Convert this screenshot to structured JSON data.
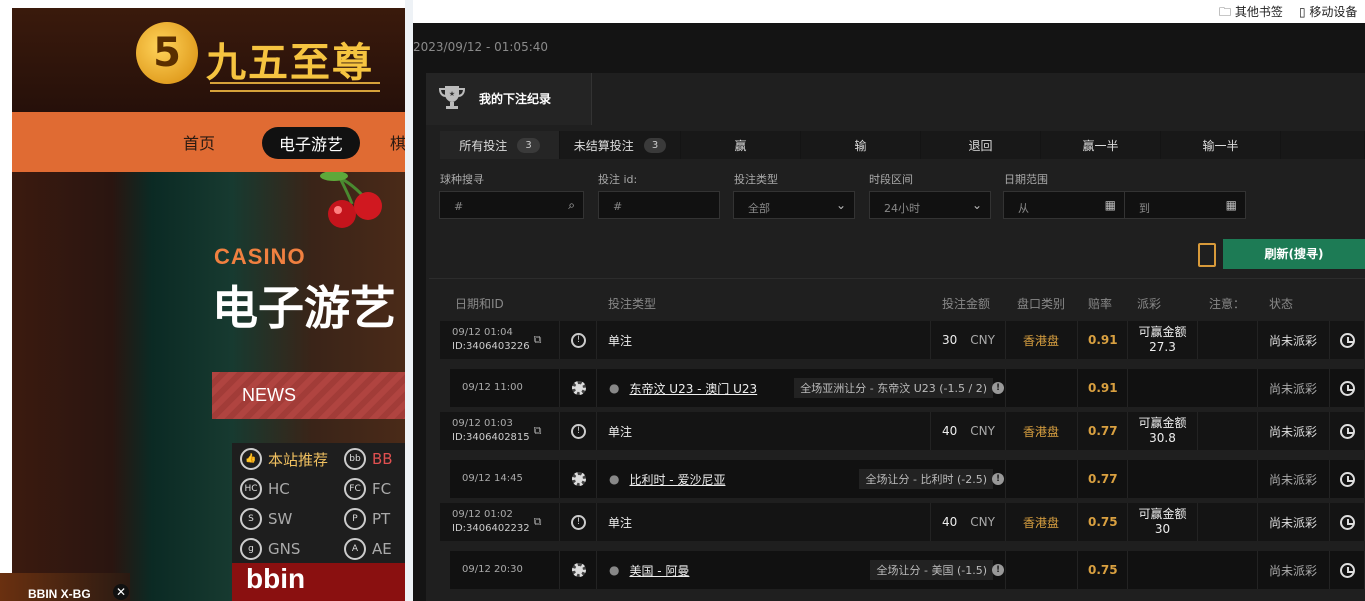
{
  "left": {
    "logo_mark": "5",
    "logo_text": "九五至尊",
    "nav": [
      "首页",
      "电子游艺",
      "棋"
    ],
    "casino_sub": "CASINO",
    "casino_title": "电子游艺",
    "news": "NEWS",
    "games": [
      {
        "icon": "thumb-icon",
        "label": "本站推荐",
        "color": "#f0c060"
      },
      {
        "icon": "bb-icon",
        "label": "BB",
        "color": "#e05050"
      },
      {
        "icon": "hc-icon",
        "label": "HC",
        "color": "#aaaaaa"
      },
      {
        "icon": "fc-icon",
        "label": "FC",
        "color": "#aaaaaa"
      },
      {
        "icon": "sw-icon",
        "label": "SW",
        "color": "#aaaaaa"
      },
      {
        "icon": "pt-icon",
        "label": "PT",
        "color": "#aaaaaa"
      },
      {
        "icon": "gns-icon",
        "label": "GNS",
        "color": "#aaaaaa"
      },
      {
        "icon": "ae-icon",
        "label": "AE",
        "color": "#aaaaaa"
      }
    ],
    "banner": "bbin",
    "corner_text": "BBIN X-BG"
  },
  "bookmarks": [
    "其他书签",
    "移动设备"
  ],
  "datetime": "2023/09/12 - 01:05:40",
  "panel_title": "我的下注纪录",
  "tabs": [
    {
      "label": "所有投注",
      "count": "3"
    },
    {
      "label": "未结算投注",
      "count": "3"
    },
    {
      "label": "赢"
    },
    {
      "label": "输"
    },
    {
      "label": "退回"
    },
    {
      "label": "赢一半"
    },
    {
      "label": "输一半"
    }
  ],
  "filters": {
    "sport_label": "球种搜寻",
    "sport_placeholder": "#",
    "id_label": "投注 id:",
    "id_placeholder": "#",
    "type_label": "投注类型",
    "type_value": "全部",
    "period_label": "时段区间",
    "period_value": "24小时",
    "date_label": "日期范围",
    "from_placeholder": "从",
    "to_placeholder": "到"
  },
  "refresh_label": "刷新(搜寻)",
  "headers": [
    "日期和ID",
    "投注类型",
    "投注金额",
    "盘口类别",
    "赔率",
    "派彩",
    "注意：",
    "状态"
  ],
  "bets": [
    {
      "date": "09/12 01:04",
      "id": "ID:3406403226",
      "type": "单注",
      "amount": "30",
      "currency": "CNY",
      "market": "香港盘",
      "odds": "0.91",
      "payout_label": "可赢金额",
      "payout": "27.3",
      "status": "尚未派彩",
      "detail": {
        "date": "09/12 11:00",
        "match": "东帝汶 U23 - 澳门 U23",
        "selection": "全场亚洲让分 - 东帝汶 U23 (-1.5 / 2)",
        "odds": "0.91",
        "status": "尚未派彩"
      }
    },
    {
      "date": "09/12 01:03",
      "id": "ID:3406402815",
      "type": "单注",
      "amount": "40",
      "currency": "CNY",
      "market": "香港盘",
      "odds": "0.77",
      "payout_label": "可赢金额",
      "payout": "30.8",
      "status": "尚未派彩",
      "detail": {
        "date": "09/12 14:45",
        "match": "比利时 - 爱沙尼亚",
        "selection": "全场让分 - 比利时 (-2.5)",
        "odds": "0.77",
        "status": "尚未派彩"
      }
    },
    {
      "date": "09/12 01:02",
      "id": "ID:3406402232",
      "type": "单注",
      "amount": "40",
      "currency": "CNY",
      "market": "香港盘",
      "odds": "0.75",
      "payout_label": "可赢金额",
      "payout": "30",
      "status": "尚未派彩",
      "detail": {
        "date": "09/12 20:30",
        "match": "美国 - 阿曼",
        "selection": "全场让分 - 美国 (-1.5)",
        "odds": "0.75",
        "status": "尚未派彩"
      }
    }
  ]
}
